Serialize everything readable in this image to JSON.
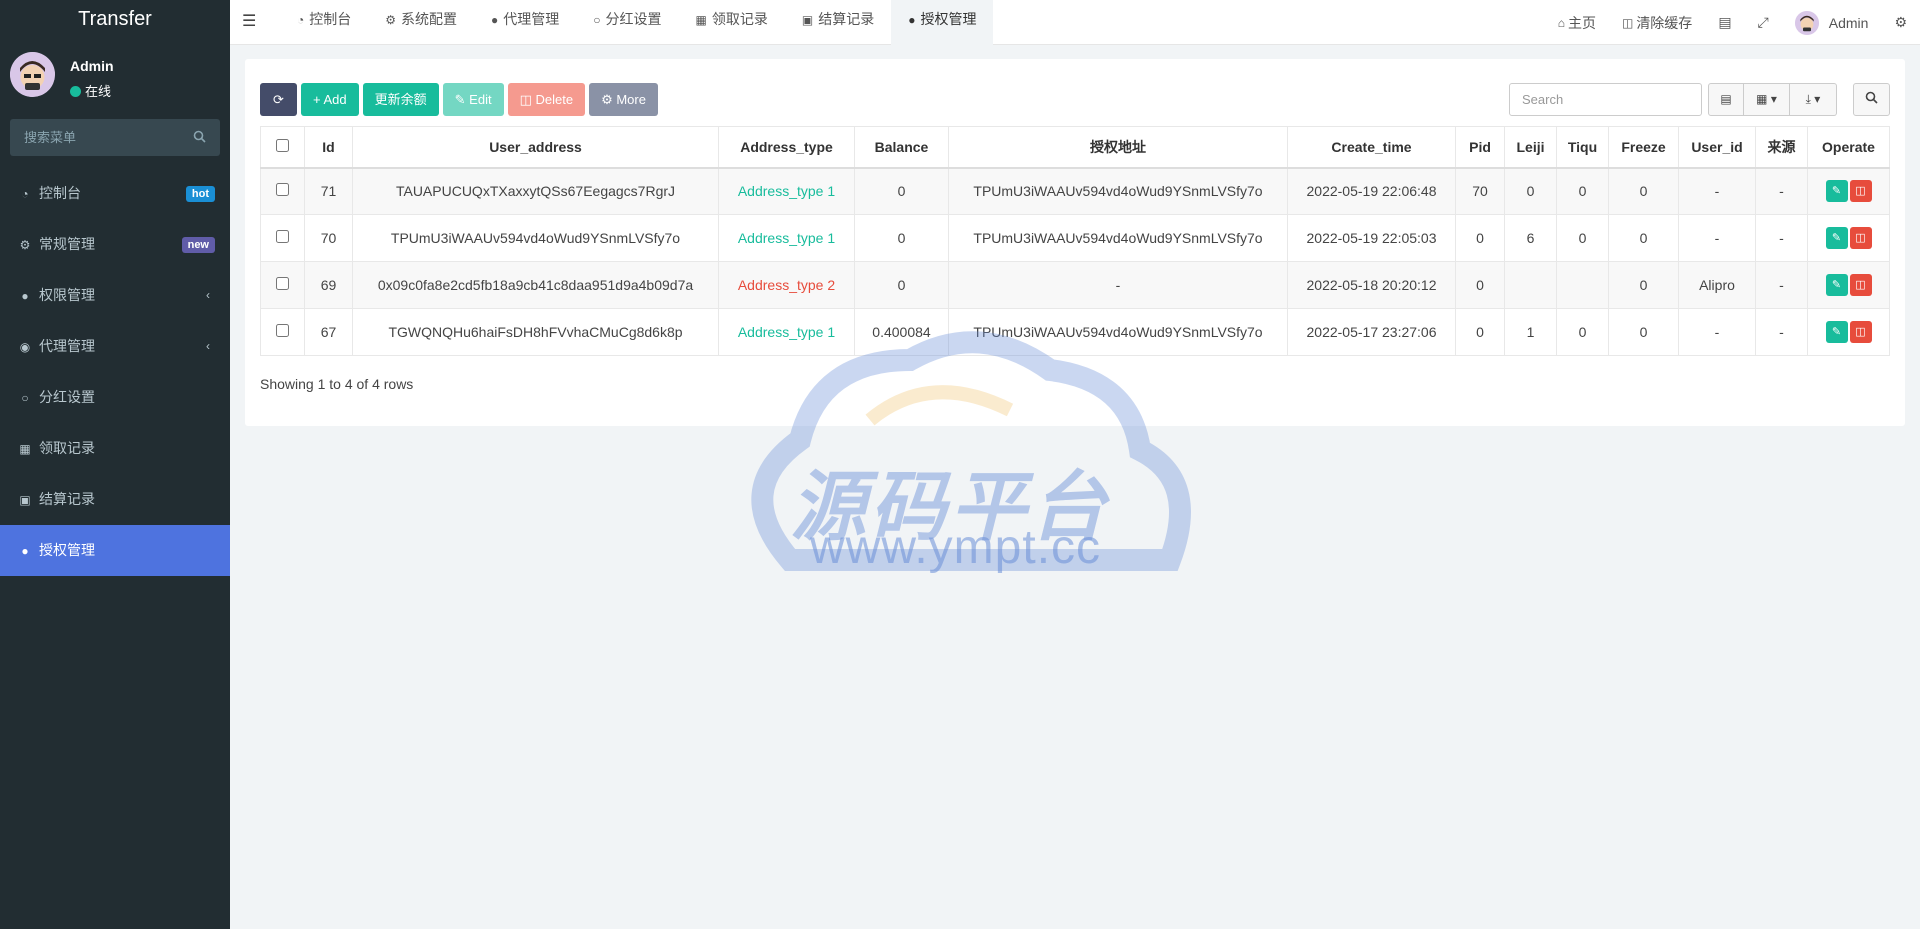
{
  "app": {
    "title": "Transfer"
  },
  "user": {
    "name": "Admin",
    "status": "在线"
  },
  "sidebar": {
    "search_placeholder": "搜索菜单",
    "items": [
      {
        "label": "控制台",
        "icon": "dashboard-icon",
        "badge": "hot"
      },
      {
        "label": "常规管理",
        "icon": "cogs-icon",
        "badge": "new"
      },
      {
        "label": "权限管理",
        "icon": "users-icon",
        "chevron": true
      },
      {
        "label": "代理管理",
        "icon": "user-circle-icon",
        "chevron": true
      },
      {
        "label": "分红设置",
        "icon": "circle-icon"
      },
      {
        "label": "领取记录",
        "icon": "bars-icon"
      },
      {
        "label": "结算记录",
        "icon": "card-icon"
      },
      {
        "label": "授权管理",
        "icon": "users-icon",
        "active": true
      }
    ]
  },
  "topnav": {
    "tabs": [
      {
        "label": "控制台",
        "icon": "dashboard-icon"
      },
      {
        "label": "系统配置",
        "icon": "gear-icon"
      },
      {
        "label": "代理管理",
        "icon": "user-icon"
      },
      {
        "label": "分红设置",
        "icon": "circle-icon"
      },
      {
        "label": "领取记录",
        "icon": "bars-icon"
      },
      {
        "label": "结算记录",
        "icon": "card-icon"
      },
      {
        "label": "授权管理",
        "icon": "users-icon",
        "active": true
      }
    ],
    "right": {
      "home": "主页",
      "clear_cache": "清除缓存",
      "user": "Admin"
    }
  },
  "toolbar": {
    "add": "Add",
    "update_balance": "更新余额",
    "edit": "Edit",
    "delete": "Delete",
    "more": "More",
    "search_placeholder": "Search"
  },
  "table": {
    "columns": [
      "Id",
      "User_address",
      "Address_type",
      "Balance",
      "授权地址",
      "Create_time",
      "Pid",
      "Leiji",
      "Tiqu",
      "Freeze",
      "User_id",
      "来源",
      "Operate"
    ],
    "rows": [
      [
        "71",
        "TAUAPUCUQxTXaxxytQSs67Eegagcs7RgrJ",
        "Address_type 1",
        "0",
        "TPUmU3iWAAUv594vd4oWud9YSnmLVSfy7o",
        "2022-05-19 22:06:48",
        "70",
        "0",
        "0",
        "0",
        "-",
        "-"
      ],
      [
        "70",
        "TPUmU3iWAAUv594vd4oWud9YSnmLVSfy7o",
        "Address_type 1",
        "0",
        "TPUmU3iWAAUv594vd4oWud9YSnmLVSfy7o",
        "2022-05-19 22:05:03",
        "0",
        "6",
        "0",
        "0",
        "-",
        "-"
      ],
      [
        "69",
        "0x09c0fa8e2cd5fb18a9cb41c8daa951d9a4b09d7a",
        "Address_type 2",
        "0",
        "-",
        "2022-05-18 20:20:12",
        "0",
        "",
        "",
        "0",
        "Alipro",
        "-"
      ],
      [
        "67",
        "TGWQNQHu6haiFsDH8hFVvhaCMuCg8d6k8p",
        "Address_type 1",
        "0.400084",
        "TPUmU3iWAAUv594vd4oWud9YSnmLVSfy7o",
        "2022-05-17 23:27:06",
        "0",
        "1",
        "0",
        "0",
        "-",
        "-"
      ]
    ],
    "footer": "Showing 1 to 4 of 4 rows"
  },
  "watermark": {
    "cn": "源码平台",
    "url": "www.ympt.cc"
  },
  "colors": {
    "sidebar_bg": "#222d32",
    "active": "#4e73df",
    "success": "#18bc9c",
    "danger": "#e74c3c"
  }
}
